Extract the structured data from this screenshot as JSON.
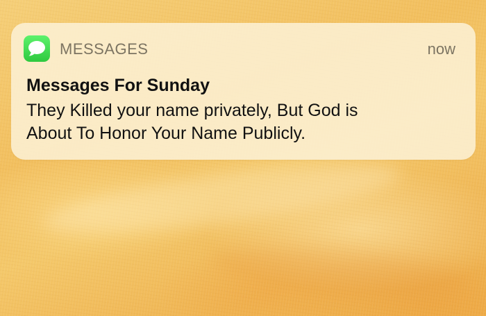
{
  "notification": {
    "app_name": "MESSAGES",
    "app_icon": "messages-speech-bubble-icon",
    "time": "now",
    "title": "Messages For Sunday",
    "body_lines": [
      "They Killed your name privately, But God is",
      "About To Honor Your Name Publicly."
    ]
  },
  "colors": {
    "icon_green": "#35d04a",
    "header_text": "#7c7462",
    "body_text": "#111111",
    "card_background": "#fcf0d4",
    "wallpaper": "#f2bf5e"
  }
}
